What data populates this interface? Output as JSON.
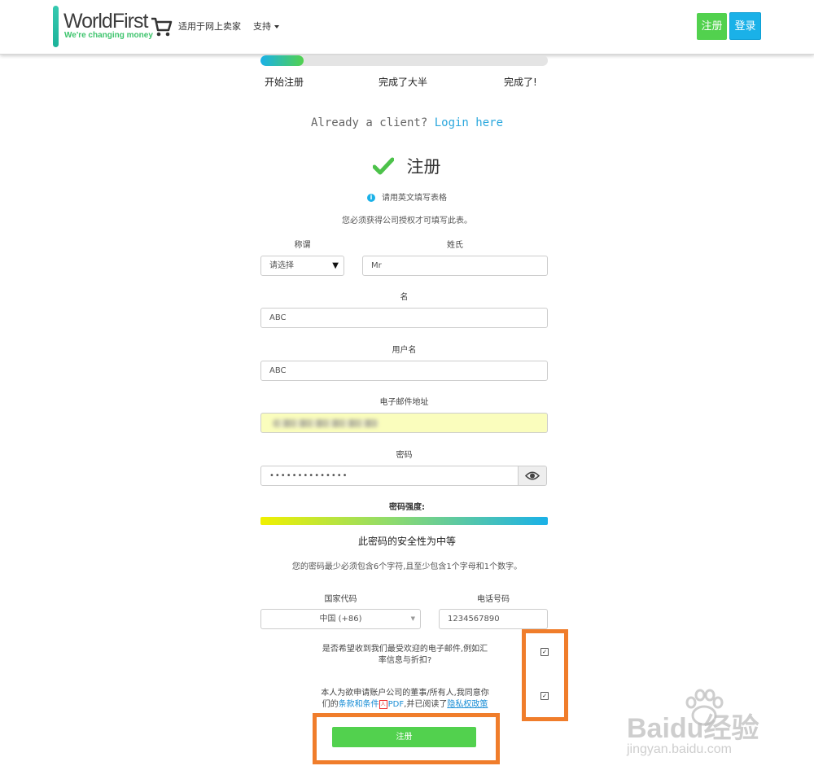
{
  "header": {
    "logo_name": "WorldFirst",
    "logo_tagline": "We're changing money",
    "nav_sellers": "适用于网上卖家",
    "nav_support": "支持",
    "register_btn": "注册",
    "login_btn": "登录"
  },
  "progress": {
    "fraction": 0.15,
    "steps": [
      "开始注册",
      "完成了大半",
      "完成了!"
    ]
  },
  "form": {
    "already_text": "Already a client?",
    "login_link": "Login here",
    "title": "注册",
    "info_note": "请用英文填写表格",
    "auth_note": "您必须获得公司授权才可填写此表。",
    "salutation_label": "称谓",
    "salutation_value": "请选择",
    "surname_label": "姓氏",
    "surname_value": "Mr",
    "firstname_label": "名",
    "firstname_value": "ABC",
    "username_label": "用户名",
    "username_value": "ABC",
    "email_label": "电子邮件地址",
    "password_label": "密码",
    "password_value": "••••••••••••••",
    "strength_label": "密码强度:",
    "strength_text": "此密码的安全性为中等",
    "password_rule": "您的密码最少必须包含6个字符,且至少包含1个字母和1个数字。",
    "country_code_label": "国家代码",
    "country_code_value": "中国 (+86)",
    "phone_label": "电话号码",
    "phone_value": "1234567890",
    "newsletter_line1": "是否希望收到我们最受欢迎的电子邮件,例如汇",
    "newsletter_line2": "率信息与折扣?",
    "terms_line1": "本人为欲申请账户公司的董事/所有人,我同意你",
    "terms_pre": "们的",
    "terms_link": "条款和条件",
    "terms_pdf": "PDF",
    "terms_mid": ",并已阅读了",
    "privacy_link": "隐私权政策",
    "submit_btn": "注册"
  },
  "watermark": {
    "brand": "Baidu经验",
    "url": "jingyan.baidu.com"
  },
  "colors": {
    "accent_green": "#52d14e",
    "accent_blue": "#1ab1e8",
    "highlight_orange": "#f07d2b",
    "email_autofill": "#fafdbd"
  }
}
